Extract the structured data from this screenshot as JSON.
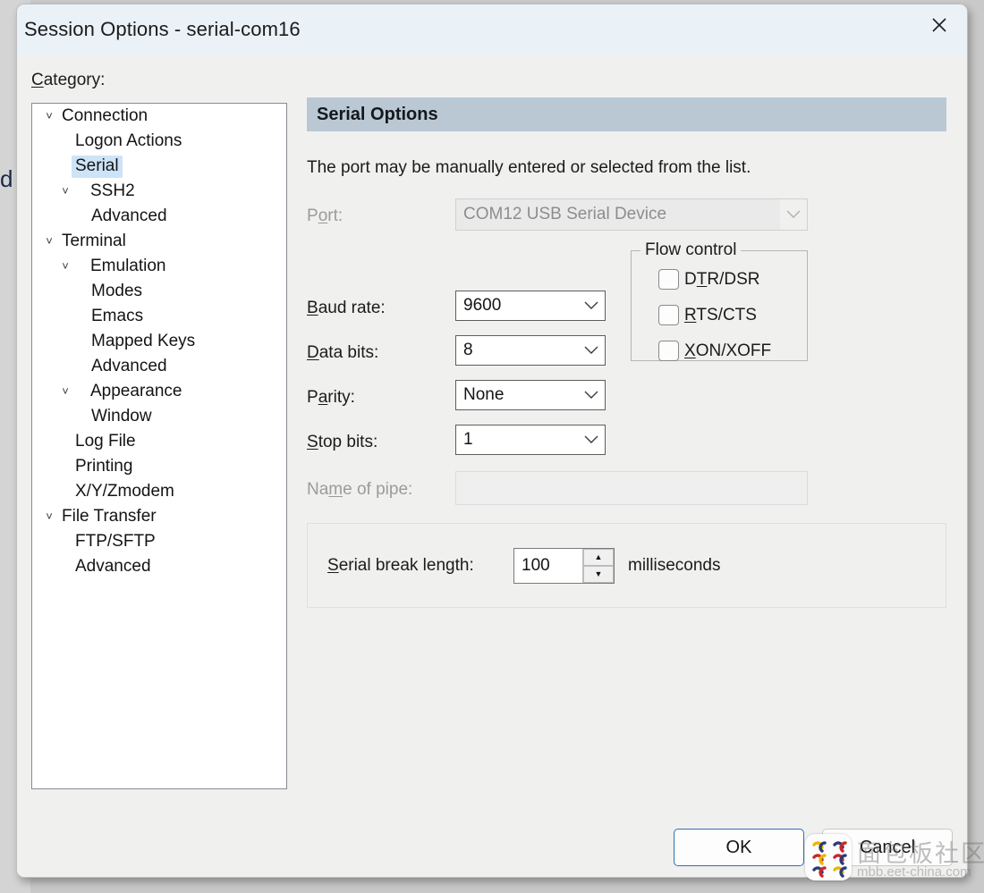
{
  "window": {
    "title": "Session Options - serial-com16",
    "close_icon": "close-icon"
  },
  "category": {
    "label": "Category:",
    "label_mnemonic": "C",
    "tree": [
      {
        "label": "Connection",
        "level": 0,
        "expander": "˅",
        "selected": false
      },
      {
        "label": "Logon Actions",
        "level": 1,
        "expander": "",
        "selected": false
      },
      {
        "label": "Serial",
        "level": 1,
        "expander": "",
        "selected": true
      },
      {
        "label": "SSH2",
        "level": 1,
        "expander": "˅",
        "selected": false
      },
      {
        "label": "Advanced",
        "level": 2,
        "expander": "",
        "selected": false
      },
      {
        "label": "Terminal",
        "level": 0,
        "expander": "˅",
        "selected": false
      },
      {
        "label": "Emulation",
        "level": 1,
        "expander": "˅",
        "selected": false
      },
      {
        "label": "Modes",
        "level": 2,
        "expander": "",
        "selected": false
      },
      {
        "label": "Emacs",
        "level": 2,
        "expander": "",
        "selected": false
      },
      {
        "label": "Mapped Keys",
        "level": 2,
        "expander": "",
        "selected": false
      },
      {
        "label": "Advanced",
        "level": 2,
        "expander": "",
        "selected": false
      },
      {
        "label": "Appearance",
        "level": 1,
        "expander": "˅",
        "selected": false
      },
      {
        "label": "Window",
        "level": 2,
        "expander": "",
        "selected": false
      },
      {
        "label": "Log File",
        "level": 1,
        "expander": "",
        "selected": false
      },
      {
        "label": "Printing",
        "level": 1,
        "expander": "",
        "selected": false
      },
      {
        "label": "X/Y/Zmodem",
        "level": 1,
        "expander": "",
        "selected": false
      },
      {
        "label": "File Transfer",
        "level": 0,
        "expander": "˅",
        "selected": false
      },
      {
        "label": "FTP/SFTP",
        "level": 1,
        "expander": "",
        "selected": false
      },
      {
        "label": "Advanced",
        "level": 1,
        "expander": "",
        "selected": false
      }
    ]
  },
  "pane": {
    "header": "Serial Options",
    "description": "The port may be manually entered or selected from the list.",
    "fields": {
      "port": {
        "label_pre": "P",
        "label_mn": "o",
        "label_post": "rt:",
        "value": "COM12 USB Serial Device",
        "disabled": true
      },
      "baud_rate": {
        "label_pre": "",
        "label_mn": "B",
        "label_post": "aud rate:",
        "value": "9600",
        "disabled": false
      },
      "data_bits": {
        "label_pre": "",
        "label_mn": "D",
        "label_post": "ata bits:",
        "value": "8",
        "disabled": false
      },
      "parity": {
        "label_pre": "P",
        "label_mn": "a",
        "label_post": "rity:",
        "value": "None",
        "disabled": false
      },
      "stop_bits": {
        "label_pre": "",
        "label_mn": "S",
        "label_post": "top bits:",
        "value": "1",
        "disabled": false
      },
      "pipe_name": {
        "label_pre": "Na",
        "label_mn": "m",
        "label_post": "e of pipe:",
        "value": "",
        "disabled": true
      }
    },
    "flow_control": {
      "title": "Flow control",
      "items": [
        {
          "pre": "D",
          "mn": "T",
          "post": "R/DSR",
          "checked": false
        },
        {
          "pre": "",
          "mn": "R",
          "post": "TS/CTS",
          "checked": false
        },
        {
          "pre": "",
          "mn": "X",
          "post": "ON/XOFF",
          "checked": false
        }
      ]
    },
    "serial_break": {
      "label_pre": "",
      "label_mn": "S",
      "label_post": "erial break length:",
      "value": "100",
      "unit": "milliseconds",
      "up_icon": "▲",
      "down_icon": "▼"
    }
  },
  "footer": {
    "ok": "OK",
    "cancel": "Cancel"
  },
  "background": {
    "fragment_text": "d"
  },
  "watermark": {
    "cn_text": "面包板社区",
    "url_text": "mbb.eet-china.com"
  }
}
